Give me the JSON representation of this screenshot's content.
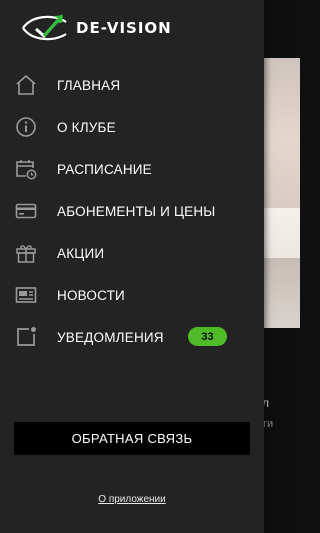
{
  "brand": {
    "name": "DE-VISION",
    "accent": "#2ebf3c"
  },
  "menu": {
    "items": [
      {
        "label": "ГЛАВНАЯ",
        "icon": "home-icon"
      },
      {
        "label": "О КЛУБЕ",
        "icon": "info-icon"
      },
      {
        "label": "РАСПИСАНИЕ",
        "icon": "calendar-clock-icon"
      },
      {
        "label": "АБОНЕМЕНТЫ И ЦЕНЫ",
        "icon": "credit-card-icon"
      },
      {
        "label": "АКЦИИ",
        "icon": "gift-icon"
      },
      {
        "label": "НОВОСТИ",
        "icon": "newspaper-icon"
      },
      {
        "label": "УВЕДОМЛЕНИЯ",
        "icon": "notification-icon",
        "badge": "33"
      }
    ]
  },
  "feedback_button": {
    "label": "ОБРАТНАЯ СВЯЗЬ"
  },
  "about_link": {
    "label": "О приложении"
  },
  "background": {
    "fragment_1": "л",
    "fragment_2": "ти"
  },
  "colors": {
    "drawer_bg": "#232323",
    "badge_bg": "#4fbb28",
    "icon": "#9a9a9a"
  }
}
